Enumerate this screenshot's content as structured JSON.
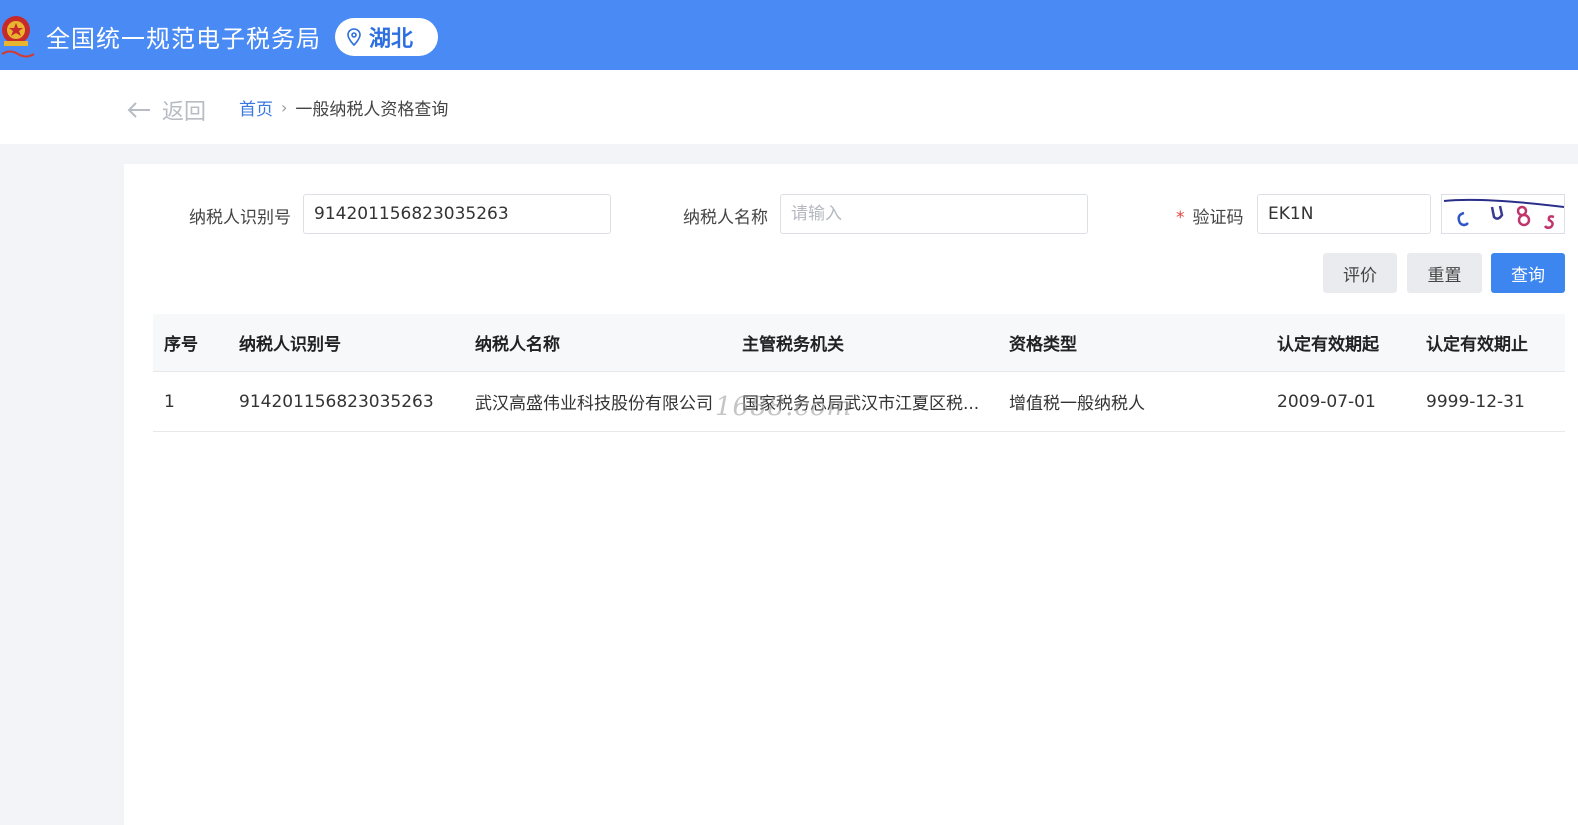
{
  "header": {
    "title": "全国统一规范电子税务局",
    "region": "湖北",
    "bg_color": "#4a8af4"
  },
  "nav": {
    "back_label": "返回",
    "breadcrumb": {
      "home": "首页",
      "separator": "›",
      "current": "一般纳税人资格查询"
    }
  },
  "form": {
    "taxpayer_id": {
      "label": "纳税人识别号",
      "value": "914201156823035263"
    },
    "taxpayer_name": {
      "label": "纳税人名称",
      "placeholder": "请输入",
      "value": ""
    },
    "captcha": {
      "required_mark": "*",
      "label": "验证码",
      "value": "EK1N"
    }
  },
  "buttons": {
    "evaluate": "评价",
    "reset": "重置",
    "query": "查询"
  },
  "table": {
    "headers": [
      "序号",
      "纳税人识别号",
      "纳税人名称",
      "主管税务机关",
      "资格类型",
      "认定有效期起",
      "认定有效期止"
    ],
    "rows": [
      [
        "1",
        "914201156823035263",
        "武汉高盛伟业科技股份有限公司",
        "国家税务总局武汉市江夏区税...",
        "增值税一般纳税人",
        "2009-07-01",
        "9999-12-31"
      ]
    ]
  },
  "watermark": "1688.com",
  "colors": {
    "primary": "#3d86f0",
    "link": "#3a78e0",
    "required": "#e0453c"
  }
}
